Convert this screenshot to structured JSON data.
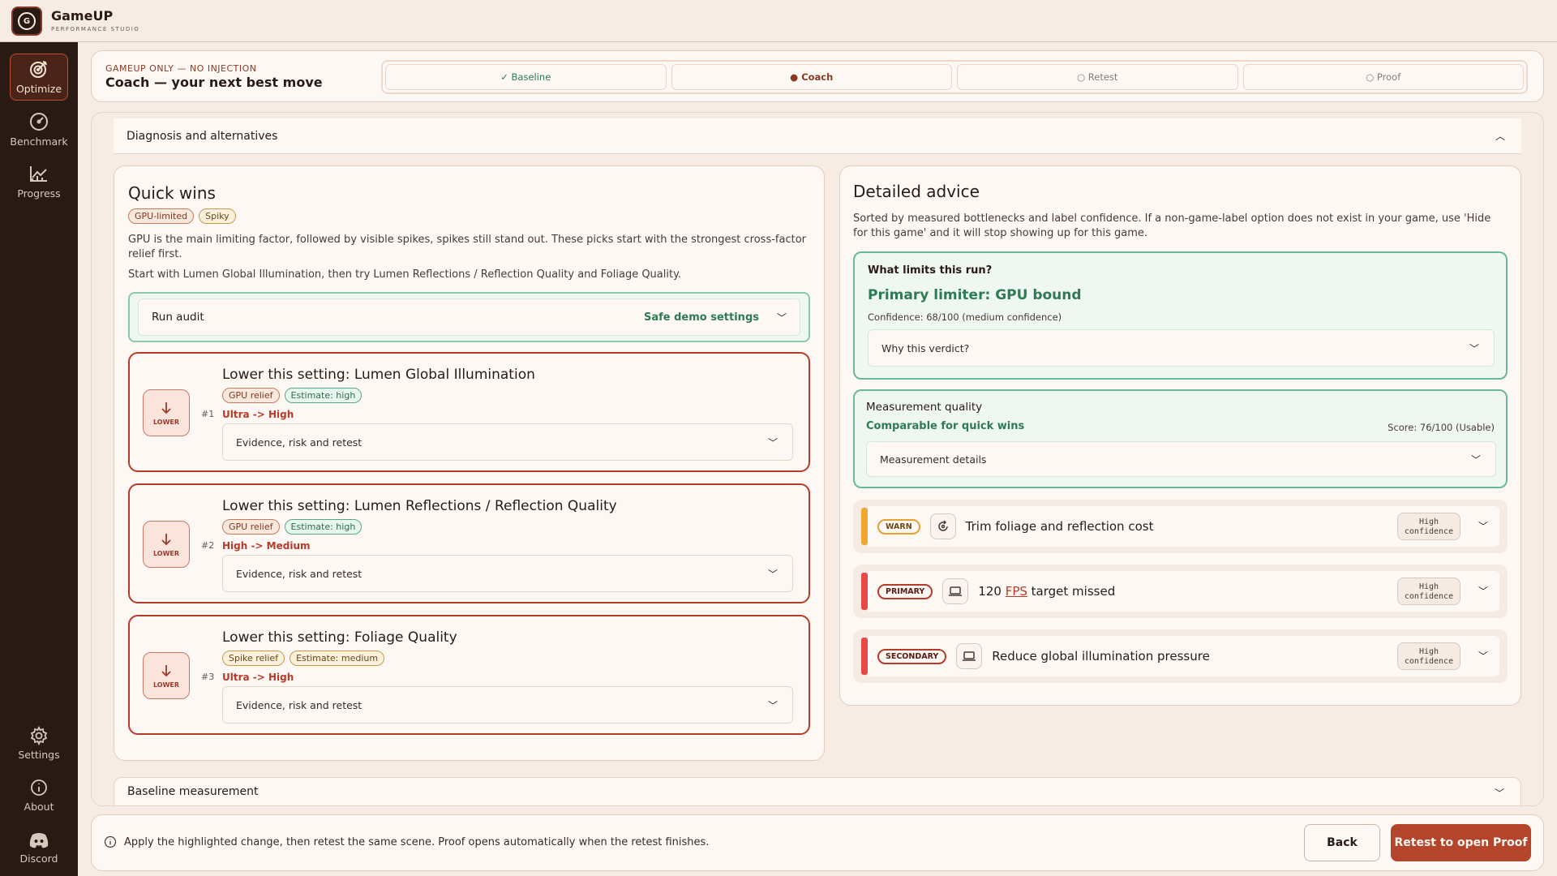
{
  "app": {
    "name": "GameUP",
    "subtitle": "PERFORMANCE STUDIO",
    "logo_letter": "G"
  },
  "sidebar": {
    "top": [
      {
        "label": "Optimize",
        "icon": "target-icon",
        "active": true
      },
      {
        "label": "Benchmark",
        "icon": "gauge-icon",
        "active": false
      },
      {
        "label": "Progress",
        "icon": "chart-icon",
        "active": false
      }
    ],
    "bottom": [
      {
        "label": "Settings",
        "icon": "gear-icon"
      },
      {
        "label": "About",
        "icon": "info-icon"
      },
      {
        "label": "Discord",
        "icon": "discord-icon"
      }
    ]
  },
  "stage": {
    "tag": "GAMEUP ONLY — NO INJECTION",
    "title": "Coach — your next best move",
    "steps": [
      {
        "label": "✓ Baseline",
        "state": "done"
      },
      {
        "label": "● Coach",
        "state": "current"
      },
      {
        "label": "○ Retest",
        "state": "pending"
      },
      {
        "label": "○ Proof",
        "state": "pending"
      }
    ]
  },
  "diagnosis": {
    "label": "Diagnosis and alternatives"
  },
  "quick_wins": {
    "title": "Quick wins",
    "tags": [
      "GPU-limited",
      "Spiky"
    ],
    "para1": "GPU is the main limiting factor, followed by visible spikes, spikes still stand out. These picks start with the strongest cross-factor relief first.",
    "para2": "Start with Lumen Global Illumination, then try Lumen Reflections / Reflection Quality and Foliage Quality.",
    "audit": {
      "label": "Run audit",
      "value": "Safe demo settings"
    },
    "lower_label": "LOWER",
    "recommendations": [
      {
        "rank": "#1",
        "title": "Lower this setting: Lumen Global Illumination",
        "relief": "GPU relief",
        "estimate": "Estimate: high",
        "change": "Ultra -> High",
        "evidence": "Evidence, risk and retest"
      },
      {
        "rank": "#2",
        "title": "Lower this setting: Lumen Reflections / Reflection Quality",
        "relief": "GPU relief",
        "estimate": "Estimate: high",
        "change": "High -> Medium",
        "evidence": "Evidence, risk and retest"
      },
      {
        "rank": "#3",
        "title": "Lower this setting: Foliage Quality",
        "relief": "Spike relief",
        "estimate": "Estimate: medium",
        "change": "Ultra -> High",
        "evidence": "Evidence, risk and retest"
      }
    ]
  },
  "advice": {
    "title": "Detailed advice",
    "para": "Sorted by measured bottlenecks and label confidence. If a non-game-label option does not exist in your game, use 'Hide for this game' and it will stop showing up for this game.",
    "limits": {
      "question": "What limits this run?",
      "verdict": "Primary limiter: GPU bound",
      "confidence": "Confidence: 68/100 (medium confidence)",
      "why": "Why this verdict?"
    },
    "quality": {
      "title": "Measurement quality",
      "status": "Comparable for quick wins",
      "score": "Score: 76/100 (Usable)",
      "details": "Measurement details"
    },
    "issues": [
      {
        "tag": "WARN",
        "title": "Trim foliage and reflection cost",
        "confidence": "High confidence",
        "stripe": "#f0a830"
      },
      {
        "tag": "PRIMARY",
        "title_pre": "120 ",
        "title_link": "FPS",
        "title_post": " target missed",
        "confidence": "High confidence",
        "stripe": "#e84848"
      },
      {
        "tag": "SECONDARY",
        "title": "Reduce global illumination pressure",
        "confidence": "High confidence",
        "stripe": "#e84848"
      }
    ]
  },
  "baseline": {
    "label": "Baseline measurement"
  },
  "footer": {
    "hint": "Apply the highlighted change, then retest the same scene. Proof opens automatically when the retest finishes.",
    "back": "Back",
    "primary": "Retest to open Proof"
  }
}
